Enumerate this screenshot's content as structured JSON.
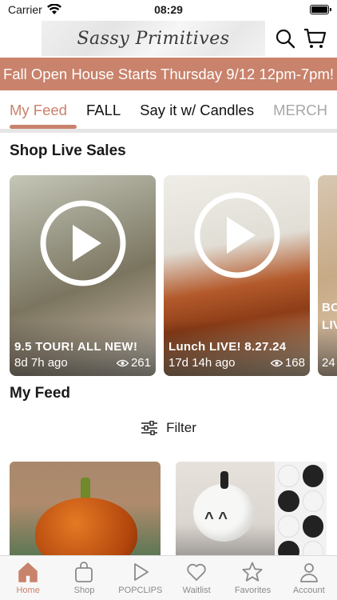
{
  "status": {
    "carrier": "Carrier",
    "time": "08:29"
  },
  "header": {
    "logo_text": "Sassy Primitives"
  },
  "banner": {
    "text": "Fall Open House Starts Thursday 9/12 12pm-7pm!"
  },
  "tabs": [
    {
      "label": "My Feed",
      "active": true
    },
    {
      "label": "FALL"
    },
    {
      "label": "Say it w/ Candles"
    },
    {
      "label": "MERCH"
    }
  ],
  "live_section": {
    "title": "Shop Live Sales",
    "cards": [
      {
        "title": "9.5 TOUR! ALL NEW!",
        "age": "8d 7h ago",
        "views": "261"
      },
      {
        "title": "Lunch LIVE! 8.27.24",
        "age": "17d 14h ago",
        "views": "168"
      },
      {
        "title_line1": "BO",
        "title_line2": "LIV",
        "age": "24"
      }
    ]
  },
  "feed_section": {
    "title": "My Feed",
    "filter_label": "Filter"
  },
  "bottom_nav": [
    {
      "label": "Home",
      "icon": "home-icon",
      "active": true
    },
    {
      "label": "Shop",
      "icon": "bag-icon"
    },
    {
      "label": "POPCLIPS",
      "icon": "play-outline-icon"
    },
    {
      "label": "Waitlist",
      "icon": "heart-icon"
    },
    {
      "label": "Favorites",
      "icon": "star-icon"
    },
    {
      "label": "Account",
      "icon": "person-icon"
    }
  ],
  "colors": {
    "accent": "#c9826b",
    "inactive": "#8a8a8a"
  }
}
